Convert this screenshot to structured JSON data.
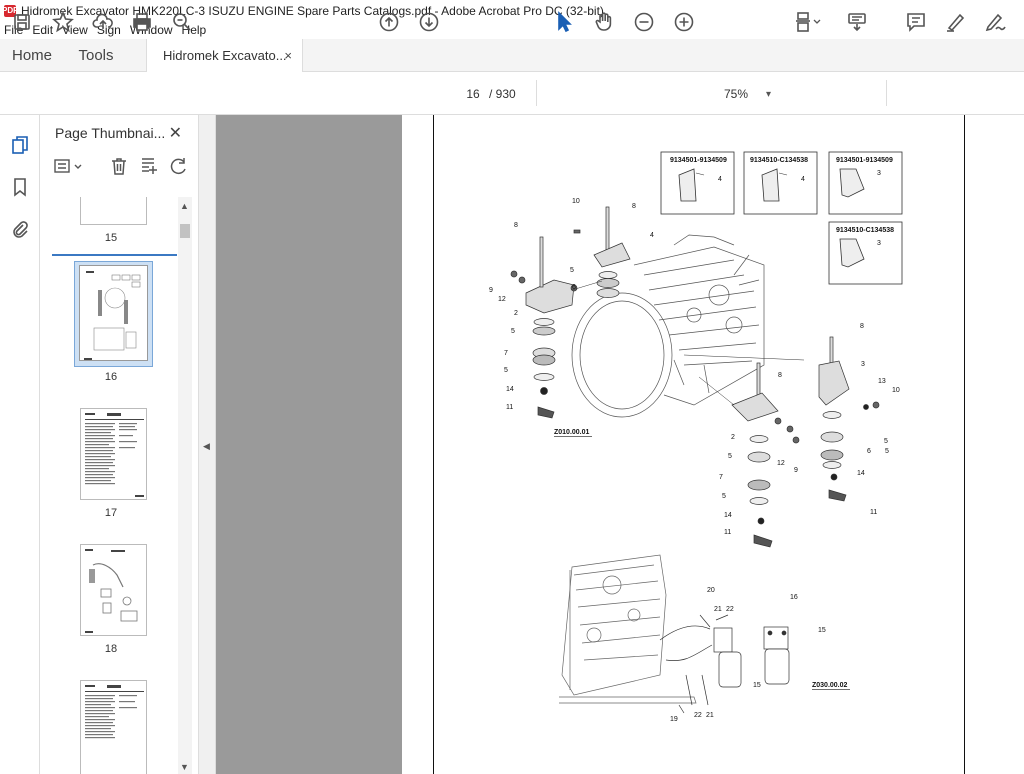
{
  "window": {
    "title": "Hidromek Excavator HMK220LC-3 ISUZU ENGINE Spare Parts Catalogs.pdf - Adobe Acrobat Pro DC (32-bit)",
    "app_icon": "PDF"
  },
  "menu": [
    "File",
    "Edit",
    "View",
    "Sign",
    "Window",
    "Help"
  ],
  "tabs": {
    "home": "Home",
    "tools": "Tools",
    "doc": "Hidromek Excavato...",
    "close": "×"
  },
  "toolbar": {
    "page_current": "16",
    "page_total": "/ 930",
    "zoom": "75%",
    "zoom_arrow": "▾"
  },
  "panel": {
    "title": "Page Thumbnai...",
    "close": "✕"
  },
  "thumbnails": [
    {
      "label": "15"
    },
    {
      "label": "16"
    },
    {
      "label": "17"
    },
    {
      "label": "18"
    }
  ],
  "diagram": {
    "boxes": [
      {
        "title": "9134501-9134509",
        "part": "4"
      },
      {
        "title": "9134510-C134538",
        "part": "4"
      },
      {
        "title": "9134501-9134509",
        "part": "3"
      },
      {
        "title": "9134510-C134538",
        "part": "3"
      }
    ],
    "ref_top": "Z010.00.01",
    "ref_bottom": "Z030.00.02",
    "callouts_top": [
      "10",
      "8",
      "8",
      "4",
      "9",
      "12",
      "5",
      "6",
      "2",
      "5",
      "7",
      "5",
      "14",
      "11"
    ],
    "callouts_right": [
      "8",
      "8",
      "3",
      "13",
      "10",
      "2",
      "5",
      "12",
      "9",
      "7",
      "5",
      "14",
      "11",
      "5",
      "6",
      "5",
      "14",
      "11"
    ],
    "callouts_bottom": [
      "20",
      "21",
      "22",
      "16",
      "15",
      "15",
      "19",
      "22",
      "21"
    ]
  }
}
